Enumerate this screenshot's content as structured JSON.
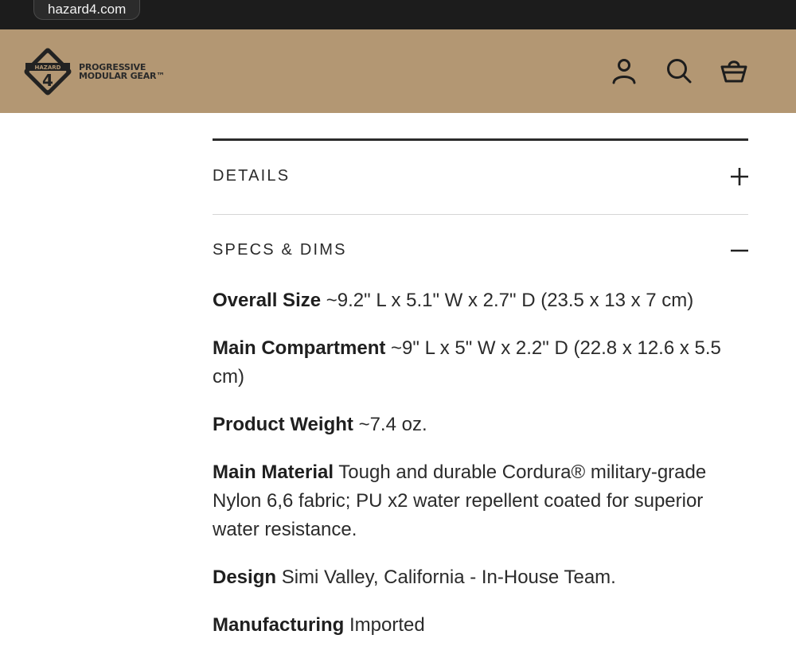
{
  "browser": {
    "url": "hazard4.com"
  },
  "header": {
    "logo": {
      "mark_text": "HAZARD",
      "mark_number": "4",
      "line1": "PROGRESSIVE",
      "line2": "MODULAR GEAR™"
    },
    "icons": [
      "account-icon",
      "search-icon",
      "cart-icon"
    ],
    "background": "#b39773"
  },
  "accordion": {
    "sections": [
      {
        "title": "DETAILS",
        "expanded": false,
        "toggle": "+"
      },
      {
        "title": "SPECS & DIMS",
        "expanded": true,
        "toggle": "−"
      }
    ]
  },
  "specs": [
    {
      "label": "Overall Size",
      "value": "~9.2\" L x 5.1\" W x 2.7\" D (23.5 x 13 x 7 cm)"
    },
    {
      "label": "Main Compartment",
      "value": "~9\" L x 5\" W x 2.2\" D (22.8 x 12.6 x 5.5 cm)"
    },
    {
      "label": "Product Weight",
      "value": "~7.4 oz."
    },
    {
      "label": "Main Material",
      "value": "Tough and durable Cordura® military-grade Nylon 6,6 fabric; PU x2 water repellent coated for superior water resistance."
    },
    {
      "label": "Design",
      "value": "Simi Valley, California - In-House Team."
    },
    {
      "label": "Manufacturing",
      "value": "Imported"
    }
  ]
}
